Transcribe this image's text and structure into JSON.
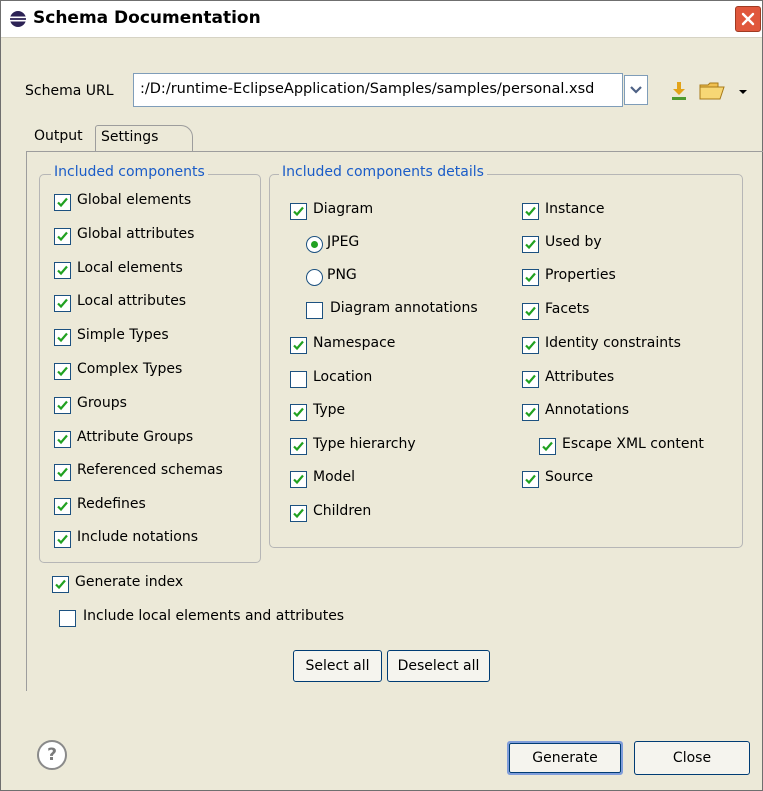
{
  "window": {
    "title": "Schema Documentation"
  },
  "schema_url": {
    "label": "Schema URL",
    "value": ":/D:/runtime-EclipseApplication/Samples/samples/personal.xsd"
  },
  "tabs": [
    {
      "label": "Output",
      "selected": false
    },
    {
      "label": "Settings",
      "selected": true
    }
  ],
  "included_components": {
    "title": "Included components",
    "items": [
      {
        "label": "Global elements",
        "checked": true
      },
      {
        "label": "Global attributes",
        "checked": true
      },
      {
        "label": "Local elements",
        "checked": true
      },
      {
        "label": "Local attributes",
        "checked": true
      },
      {
        "label": "Simple Types",
        "checked": true
      },
      {
        "label": "Complex Types",
        "checked": true
      },
      {
        "label": "Groups",
        "checked": true
      },
      {
        "label": "Attribute Groups",
        "checked": true
      },
      {
        "label": "Referenced schemas",
        "checked": true
      },
      {
        "label": "Redefines",
        "checked": true
      },
      {
        "label": "Include notations",
        "checked": true
      }
    ]
  },
  "details": {
    "title": "Included components details",
    "diagram": {
      "label": "Diagram",
      "checked": true
    },
    "jpeg": {
      "label": "JPEG",
      "selected": true
    },
    "png": {
      "label": "PNG",
      "selected": false
    },
    "diagram_annotations": {
      "label": "Diagram annotations",
      "checked": false
    },
    "namespace": {
      "label": "Namespace",
      "checked": true
    },
    "location": {
      "label": "Location",
      "checked": false
    },
    "type": {
      "label": "Type",
      "checked": true
    },
    "type_hierarchy": {
      "label": "Type hierarchy",
      "checked": true
    },
    "model": {
      "label": "Model",
      "checked": true
    },
    "children": {
      "label": "Children",
      "checked": true
    },
    "instance": {
      "label": "Instance",
      "checked": true
    },
    "used_by": {
      "label": "Used by",
      "checked": true
    },
    "properties": {
      "label": "Properties",
      "checked": true
    },
    "facets": {
      "label": "Facets",
      "checked": true
    },
    "identity_constraints": {
      "label": "Identity constraints",
      "checked": true
    },
    "attributes": {
      "label": "Attributes",
      "checked": true
    },
    "annotations": {
      "label": "Annotations",
      "checked": true
    },
    "escape_xml": {
      "label": "Escape XML content",
      "checked": true
    },
    "source": {
      "label": "Source",
      "checked": true
    }
  },
  "generate_index": {
    "label": "Generate index",
    "checked": true
  },
  "include_local": {
    "label": "Include local elements and attributes",
    "checked": false
  },
  "buttons": {
    "select_all": "Select all",
    "deselect_all": "Deselect all",
    "generate": "Generate",
    "close": "Close",
    "help": "?"
  },
  "icons": {
    "title": "eclipse-icon",
    "download": "download-icon",
    "folder": "folder-icon"
  }
}
